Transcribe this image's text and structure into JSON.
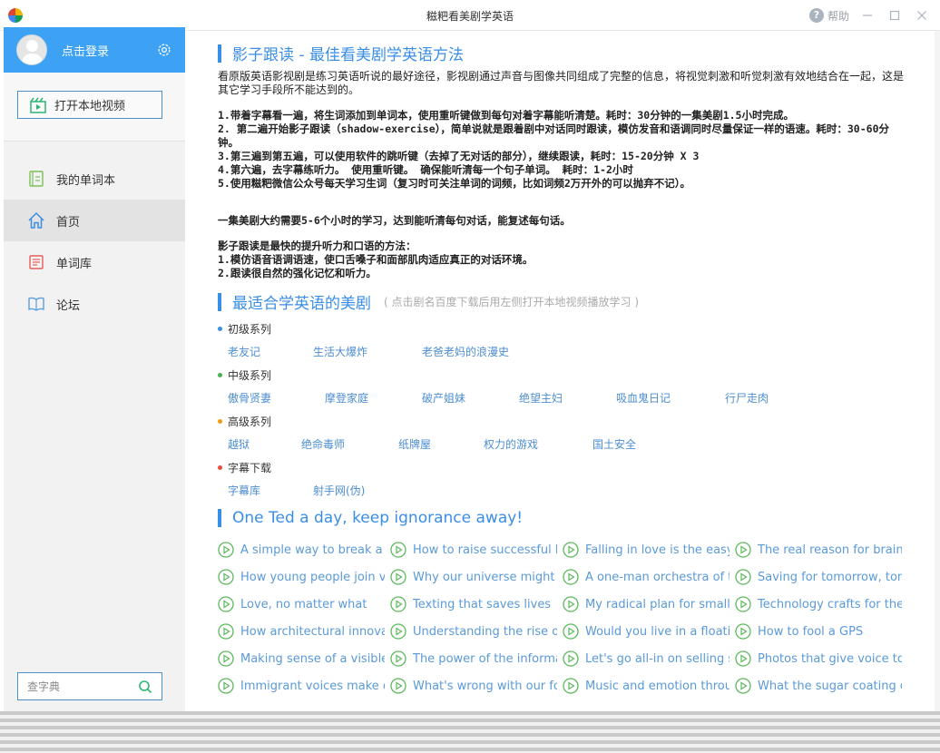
{
  "window": {
    "title": "糍粑看美剧学英语",
    "help_label": "帮助"
  },
  "sidebar": {
    "login_label": "点击登录",
    "open_video_label": "打开本地视频",
    "nav": [
      {
        "label": "我的单词本",
        "icon": "notebook-icon"
      },
      {
        "label": "首页",
        "icon": "home-icon",
        "active": true
      },
      {
        "label": "单词库",
        "icon": "word-library-icon"
      },
      {
        "label": "论坛",
        "icon": "book-icon"
      }
    ],
    "dict_placeholder": "查字典"
  },
  "main": {
    "section1": {
      "title": "影子跟读 - 最佳看美剧学英语方法",
      "intro": "看原版英语影视剧是练习英语听说的最好途径，影视剧通过声音与图像共同组成了完整的信息，将视觉刺激和听觉刺激有效地结合在一起，这是其它学习手段所不能达到的。",
      "steps": [
        "1.带着字幕看一遍，将生词添加到单词本，使用重听键做到每句对着字幕能听清楚。耗时：30分钟的一集美剧1.5小时完成。",
        "2. 第二遍开始影子跟读（shadow-exercise），简单说就是跟着剧中对话同时跟读，模仿发音和语调同时尽量保证一样的语速。耗时：30-60分钟。",
        "3.第三遍到第五遍，可以使用软件的跳听键（去掉了无对话的部分），继续跟读，耗时：15-20分钟 X 3",
        "4.第六遍，去字幕练听力。 使用重听键。 确保能听清每一个句子单词。 耗时：1-2小时",
        "5.使用糍粑微信公众号每天学习生词（复习时可关注单词的词频，比如词频2万开外的可以抛弃不记）。"
      ],
      "summary": "一集美剧大约需要5-6个小时的学习，达到能听清每句对话，能复述每句话。",
      "method_title": "影子跟读是最快的提升听力和口语的方法：",
      "method_points": [
        "1.模仿语音语调语速，使口舌嗓子和面部肌肉适应真正的对话环境。",
        "2.跟读很自然的强化记忆和听力。"
      ]
    },
    "section2": {
      "title": "最适合学英语的美剧",
      "hint": "(  点击剧名百度下载后用左侧打开本地视频播放学习  )",
      "series": [
        {
          "name": "初级系列",
          "color": "#3a8ee6",
          "shows": [
            "老友记",
            "生活大爆炸",
            "老爸老妈的浪漫史"
          ]
        },
        {
          "name": "中级系列",
          "color": "#4caf50",
          "shows": [
            "傲骨贤妻",
            "摩登家庭",
            "破产姐妹",
            "绝望主妇",
            "吸血鬼日记",
            "行尸走肉"
          ]
        },
        {
          "name": "高级系列",
          "color": "#f39c12",
          "shows": [
            "越狱",
            "绝命毒师",
            "纸牌屋",
            "权力的游戏",
            "国土安全"
          ]
        },
        {
          "name": "字幕下载",
          "color": "#e74c3c",
          "shows": [
            "字幕库",
            "射手网(伪)"
          ]
        }
      ]
    },
    "section3": {
      "title": "One Ted a day, keep ignorance away!",
      "talks": [
        "A simple way to break a b",
        "How to raise successful k",
        "Falling in love is the easy",
        "The real reason for brains",
        "How young people join vi",
        "Why our universe might e",
        "A one-man orchestra of t",
        "Saving for tomorrow, tom",
        "Love, no matter what",
        "Texting that saves lives",
        "My radical plan for small",
        "Technology crafts for the",
        "How architectural innova",
        "Understanding the rise of",
        "Would you live in a floatir",
        "How to fool a GPS",
        "Making sense of a visible",
        "The power of the informa",
        "Let's go all-in on selling s",
        "Photos that give voice to",
        "Immigrant voices make d",
        "What's wrong with our fo",
        "Music and emotion throu",
        "What the sugar coating o"
      ]
    }
  },
  "colors": {
    "accent": "#3a8ee6",
    "sidebar_header": "#3da2f4",
    "ted_green": "#5cb85c",
    "link": "#4d8ed1"
  }
}
